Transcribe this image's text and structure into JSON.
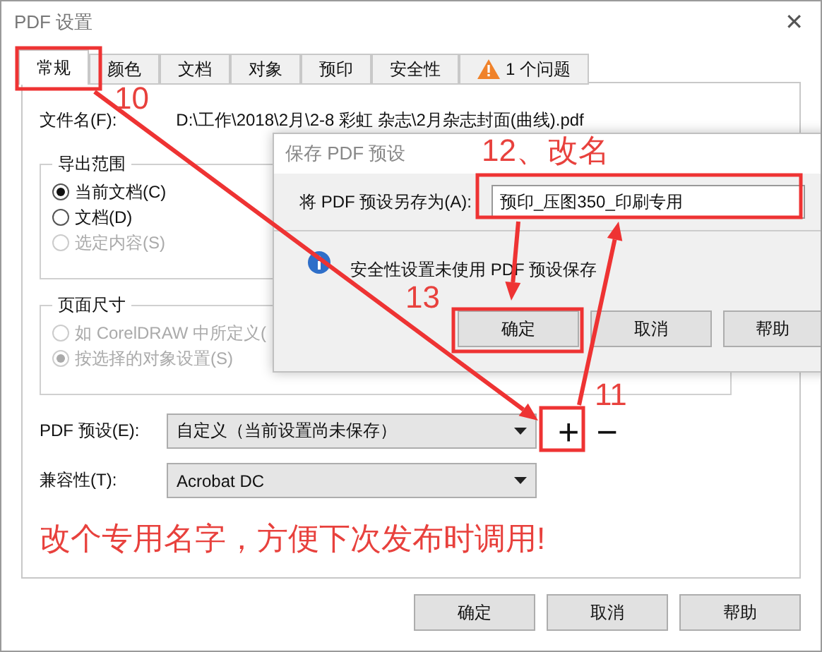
{
  "window": {
    "title": "PDF 设置",
    "close": "✕"
  },
  "tabs": [
    {
      "label": "常规",
      "selected": true,
      "kind": "plain"
    },
    {
      "label": "颜色",
      "selected": false,
      "kind": "plain"
    },
    {
      "label": "文档",
      "selected": false,
      "kind": "plain"
    },
    {
      "label": "对象",
      "selected": false,
      "kind": "plain"
    },
    {
      "label": "预印",
      "selected": false,
      "kind": "plain"
    },
    {
      "label": "安全性",
      "selected": false,
      "kind": "plain"
    },
    {
      "label": "1 个问题",
      "selected": false,
      "kind": "warning"
    }
  ],
  "general": {
    "file_label": "文件名(F):",
    "file_path": "D:\\工作\\2018\\2月\\2-8 彩虹 杂志\\2月杂志封面(曲线).pdf",
    "export_range": {
      "title": "导出范围",
      "options": [
        {
          "label": "当前文档(C)",
          "selected": true,
          "disabled": false
        },
        {
          "label": "文档(D)",
          "selected": false,
          "disabled": false
        },
        {
          "label": "选定内容(S)",
          "selected": false,
          "disabled": true
        }
      ]
    },
    "page_size": {
      "title": "页面尺寸",
      "options": [
        {
          "label": "如 CorelDRAW 中所定义(",
          "selected": false,
          "disabled": true
        },
        {
          "label": "按选择的对象设置(S)",
          "selected": true,
          "disabled": true
        }
      ]
    },
    "preset": {
      "label": "PDF 预设(E):",
      "value": "自定义（当前设置尚未保存）",
      "add": "+",
      "remove": "−"
    },
    "compatibility": {
      "label": "兼容性(T):",
      "value": "Acrobat DC"
    }
  },
  "buttons": [
    "确定",
    "取消",
    "帮助"
  ],
  "save_dialog": {
    "title": "保存 PDF 预设",
    "label": "将 PDF 预设另存为(A):",
    "value": "预印_压图350_印刷专用",
    "info": "安全性设置未使用 PDF 预设保存",
    "buttons": [
      "确定",
      "取消",
      "帮助"
    ]
  },
  "annotations": [
    {
      "text": "10"
    },
    {
      "text": "12、改名"
    },
    {
      "text": "13"
    },
    {
      "text": "11"
    }
  ],
  "annotation_note": "改个专用名字，方便下次发布时调用!"
}
